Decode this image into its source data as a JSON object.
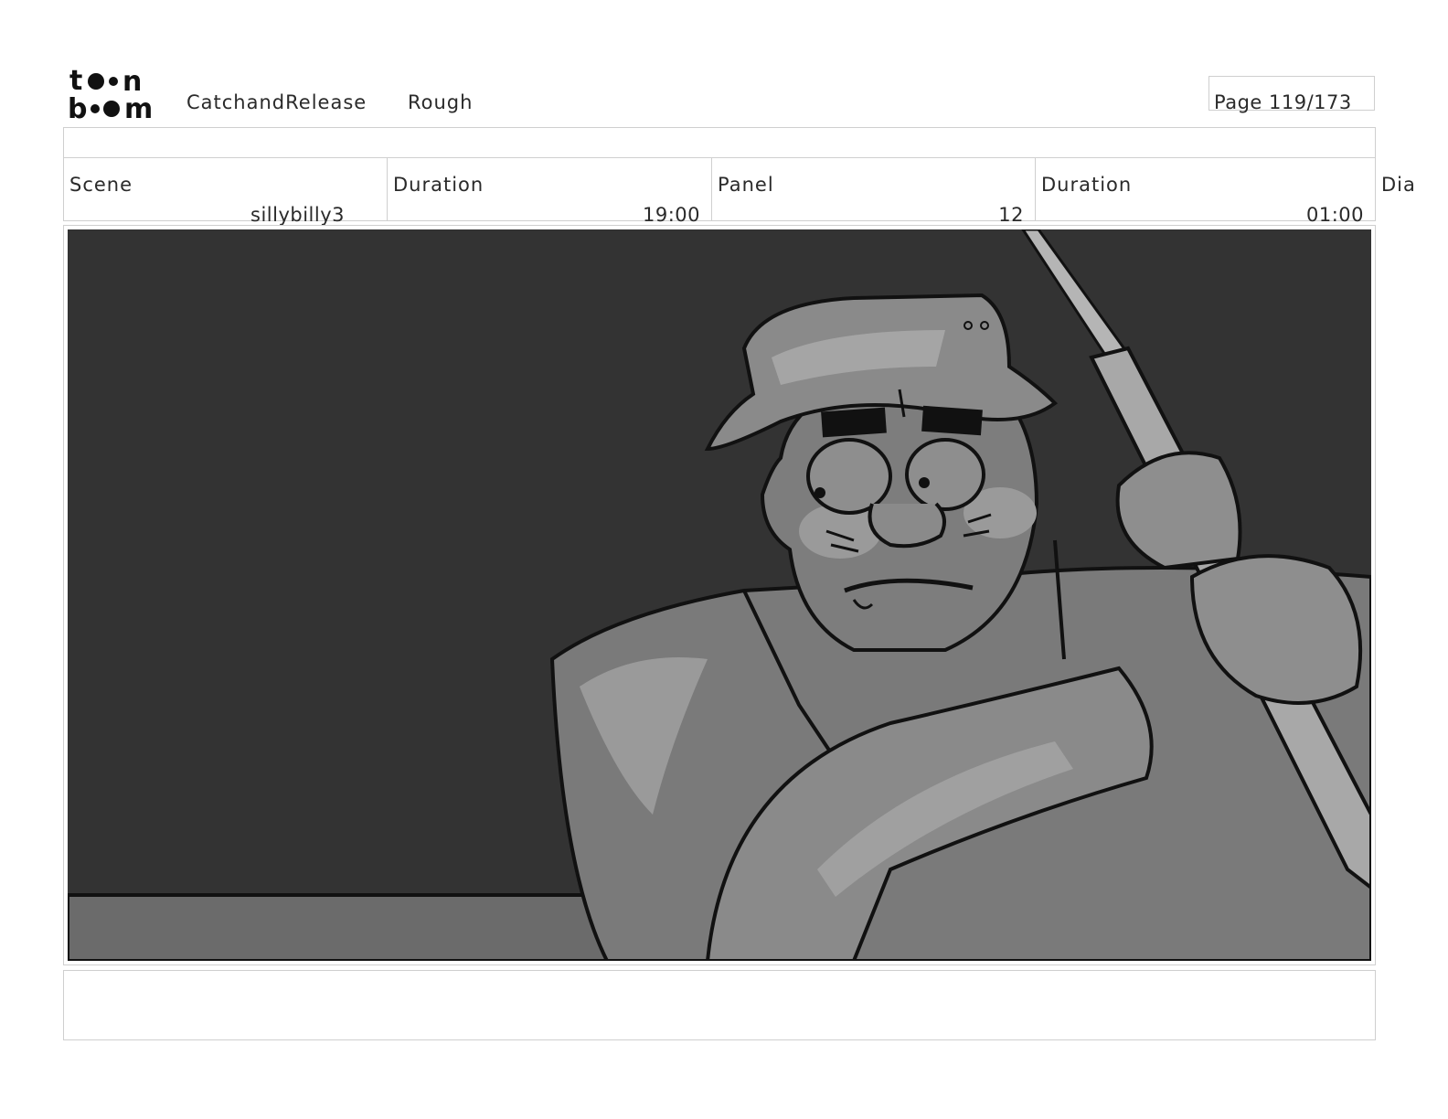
{
  "header": {
    "logo_text_top": "toon",
    "logo_text_bottom": "boom",
    "project": "CatchandRelease",
    "status": "Rough",
    "page": "Page 119/173"
  },
  "info": {
    "scene_label": "Scene",
    "scene_value": "sillybilly3",
    "scene_duration_label": "Duration",
    "scene_duration_value": "19:00",
    "panel_label": "Panel",
    "panel_value": "12",
    "panel_duration_label": "Duration",
    "panel_duration_value": "01:00",
    "dialogue_label": "Dia"
  },
  "colors": {
    "background": "#333333",
    "character_fill": "#7a7a7a",
    "character_highlight": "#9a9a9a",
    "outline": "#111111"
  }
}
